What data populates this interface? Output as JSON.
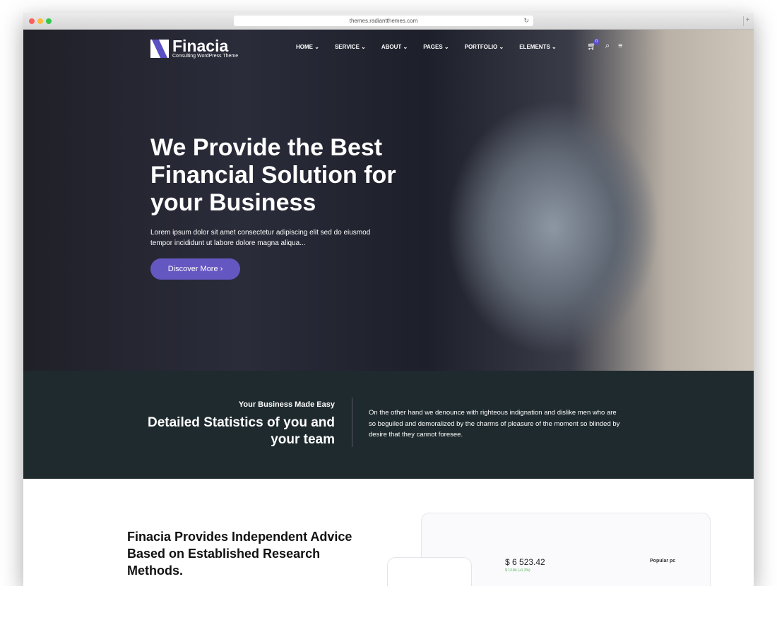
{
  "browser": {
    "url": "themes.radiantthemes.com"
  },
  "logo": {
    "name": "Finacia",
    "tagline": "Consulting WordPress Theme"
  },
  "nav": {
    "items": [
      "HOME",
      "SERVICE",
      "ABOUT",
      "PAGES",
      "PORTFOLIO",
      "ELEMENTS"
    ],
    "cart_count": "0"
  },
  "hero": {
    "title": "We Provide the Best Financial Solution for your Business",
    "text": "Lorem ipsum dolor sit amet consectetur adipiscing elit sed do eiusmod tempor incididunt ut labore dolore magna aliqua...",
    "button": "Discover More ›"
  },
  "band": {
    "kicker": "Your Business Made Easy",
    "title": "Detailed Statistics of you and your team",
    "text": "On the other hand we denounce with righteous indignation and dislike men who are so beguiled and demoralized by the charms of pleasure of the moment so blinded by desire that they cannot foresee."
  },
  "section": {
    "title": "Finacia Provides Independent Advice Based on Established Research Methods.",
    "price": "$ 6 523.42",
    "change": "$ 13.84 (+1.2%)",
    "popular": "Popular pc"
  },
  "colors": {
    "accent": "#6557c1",
    "band": "#1f2a2e"
  }
}
